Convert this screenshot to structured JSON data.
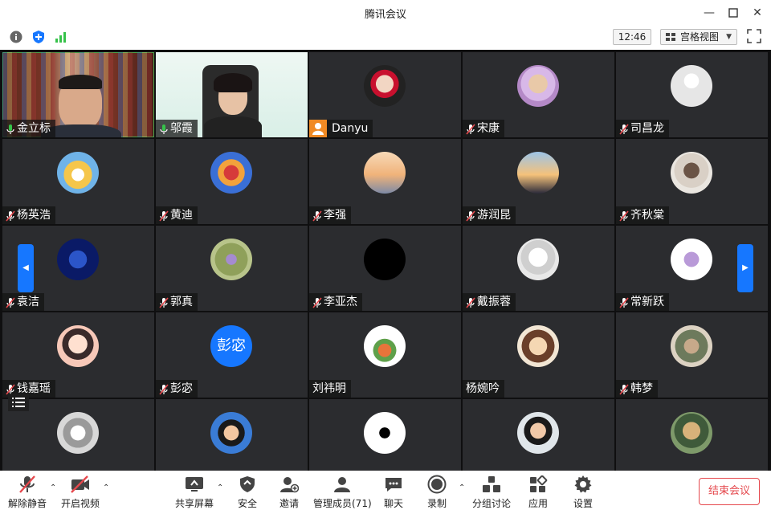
{
  "window": {
    "title": "腾讯会议"
  },
  "toolbar": {
    "clock": "12:46",
    "view_label": "宫格视图"
  },
  "participants": [
    {
      "name": "金立标"
    },
    {
      "name": "邬霞"
    },
    {
      "name": "Danyu"
    },
    {
      "name": "宋康"
    },
    {
      "name": "司昌龙"
    },
    {
      "name": "杨英浩"
    },
    {
      "name": "黄迪"
    },
    {
      "name": "李强"
    },
    {
      "name": "游润昆"
    },
    {
      "name": "齐秋棠"
    },
    {
      "name": "袁洁"
    },
    {
      "name": "郭真"
    },
    {
      "name": "李亚杰"
    },
    {
      "name": "戴振蓉"
    },
    {
      "name": "常新跃"
    },
    {
      "name": "钱嘉瑶"
    },
    {
      "name": "彭宓"
    },
    {
      "name": "刘祎明"
    },
    {
      "name": "杨婉吟"
    },
    {
      "name": "韩梦"
    }
  ],
  "avatar_text": {
    "peng": "彭宓"
  },
  "bottombar": {
    "unmute": "解除静音",
    "start_video": "开启视频",
    "share_screen": "共享屏幕",
    "security": "安全",
    "invite": "邀请",
    "manage_members": "管理成员(71)",
    "chat": "聊天",
    "record": "录制",
    "breakout": "分组讨论",
    "apps": "应用",
    "settings": "设置",
    "end_meeting": "结束会议"
  },
  "colors": {
    "accent": "#1677ff",
    "end": "#e5484d",
    "mic_on": "#36c24a",
    "mic_off": "#e5484d"
  }
}
